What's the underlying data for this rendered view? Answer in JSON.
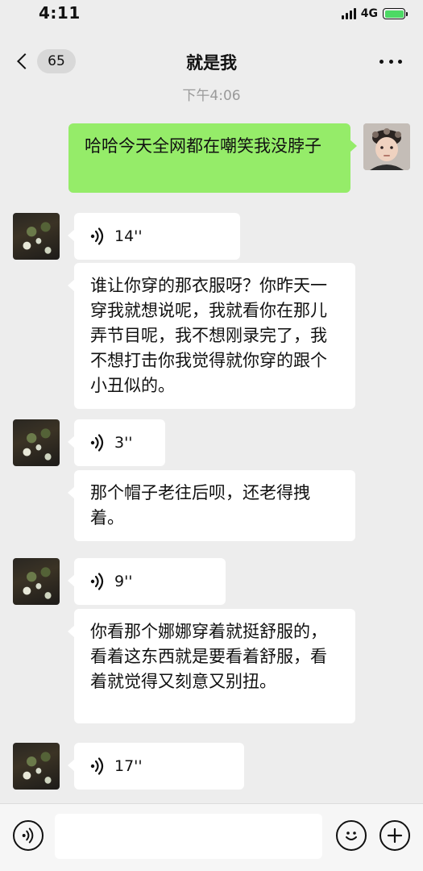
{
  "status_bar": {
    "time": "4:11",
    "network": "4G"
  },
  "nav": {
    "unread_count": "65",
    "title": "就是我"
  },
  "timestamp": "下午4:06",
  "messages": [
    {
      "sender": "me",
      "type": "text",
      "text": "哈哈今天全网都在嘲笑我没脖子"
    },
    {
      "sender": "other",
      "type": "voice",
      "duration": "14''"
    },
    {
      "sender": "other",
      "type": "text",
      "text": "谁让你穿的那衣服呀？你昨天一穿我就想说呢，我就看你在那儿弄节目呢，我不想刚录完了，我不想打击你我觉得就你穿的跟个小丑似的。"
    },
    {
      "sender": "other",
      "type": "voice",
      "duration": "3''"
    },
    {
      "sender": "other",
      "type": "text",
      "text": "那个帽子老往后呗，还老得拽着。"
    },
    {
      "sender": "other",
      "type": "voice",
      "duration": "9''"
    },
    {
      "sender": "other",
      "type": "text",
      "text": "你看那个娜娜穿着就挺舒服的，看着这东西就是要看着舒服，看着就觉得又刻意又别扭。"
    },
    {
      "sender": "other",
      "type": "voice",
      "duration": "17''"
    }
  ],
  "input_bar": {
    "placeholder": ""
  },
  "colors": {
    "background": "#ededed",
    "my_bubble": "#95ec69",
    "other_bubble": "#ffffff",
    "battery_fill": "#4cd964"
  },
  "icons": {
    "voice_toggle": "voice-circle-icon",
    "emoji": "smiley-icon",
    "more": "plus-circle-icon",
    "voice_message": "sound-wave-icon"
  }
}
